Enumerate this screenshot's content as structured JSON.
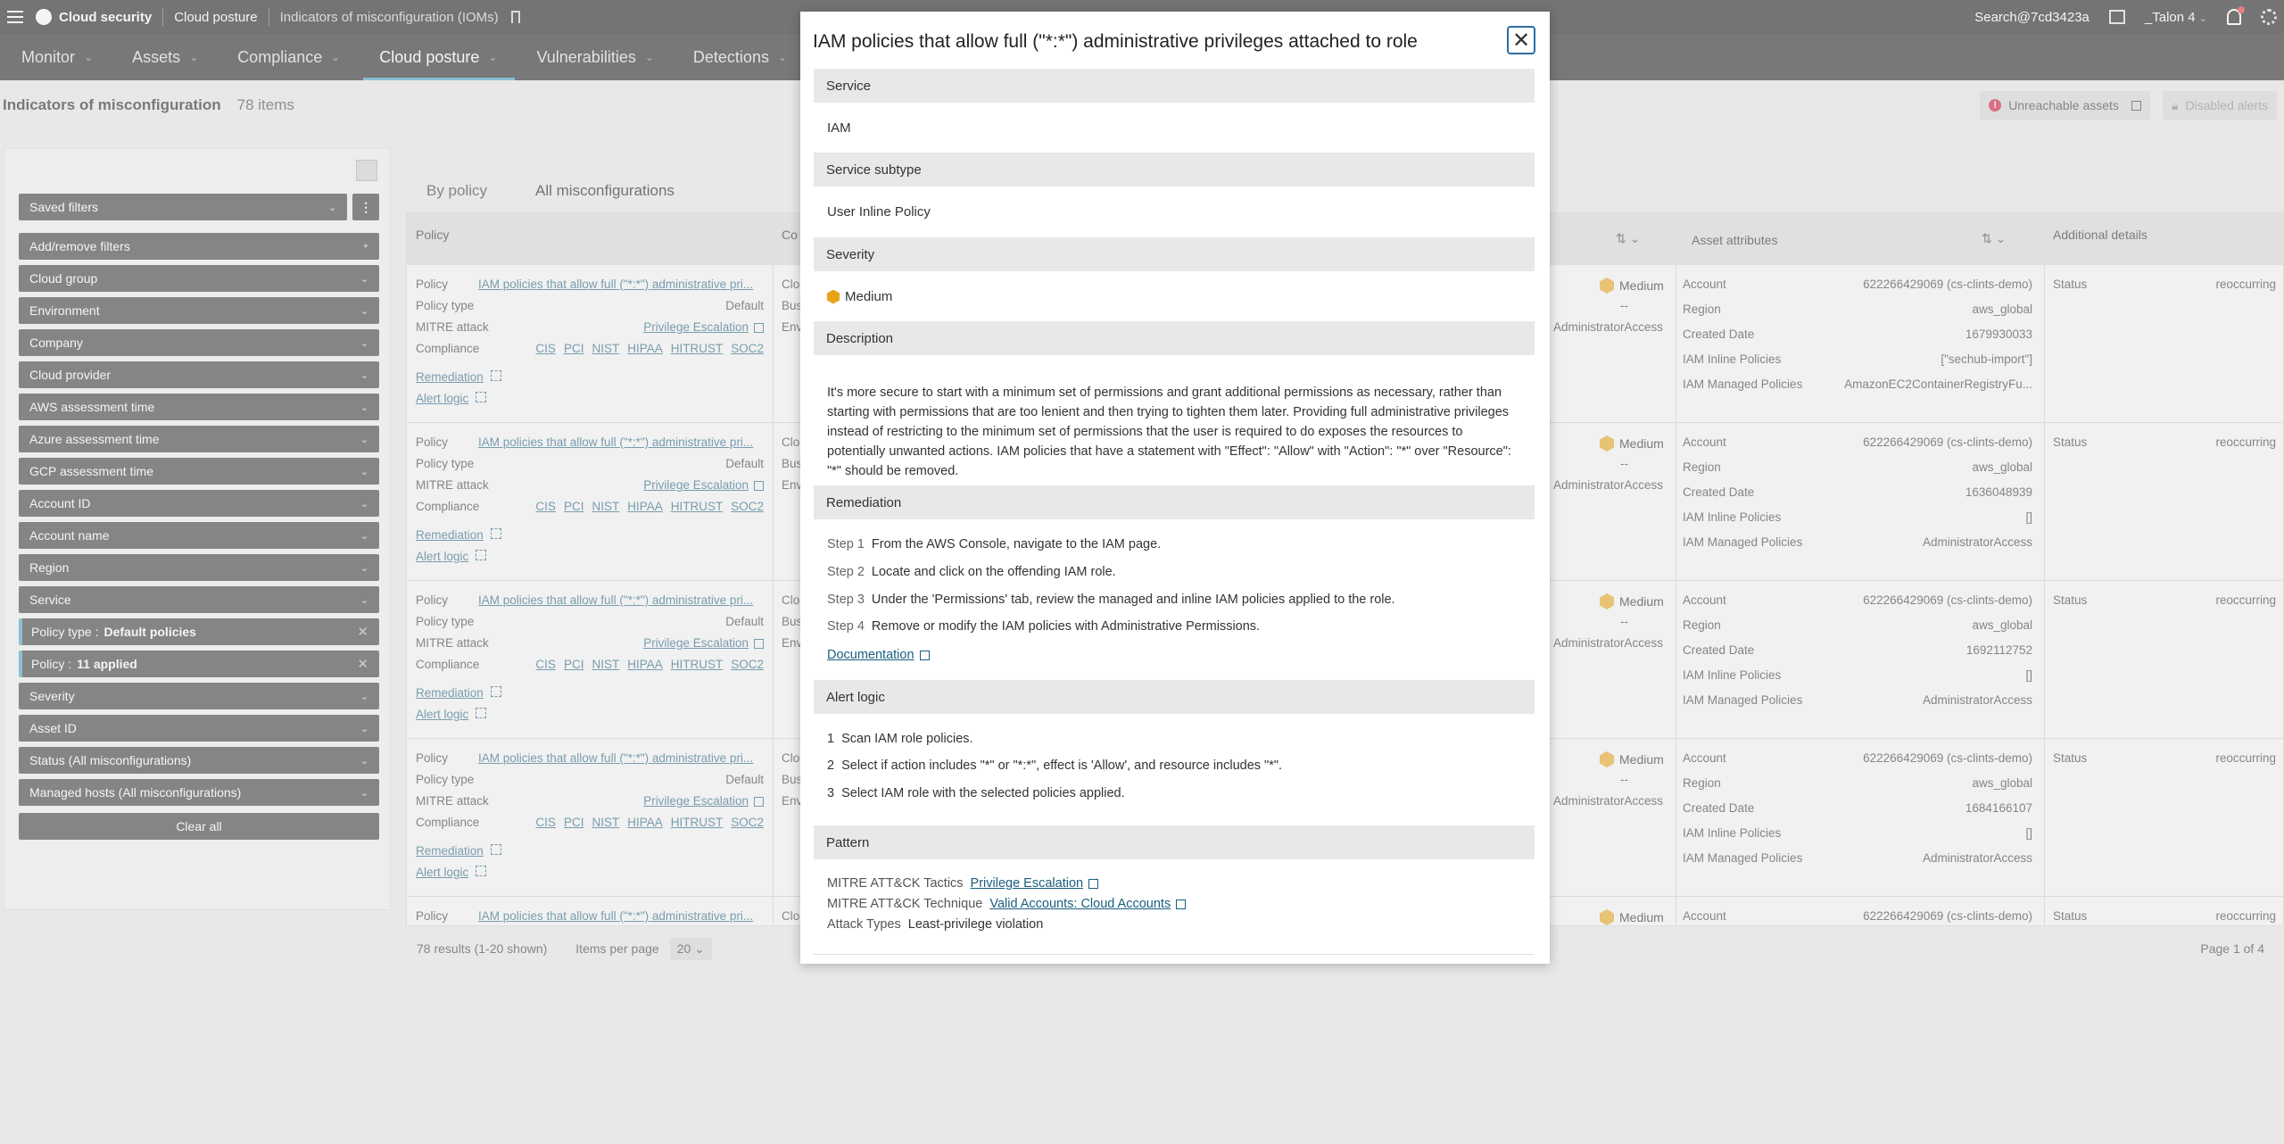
{
  "topbar": {
    "brand": "Cloud security",
    "crumb1": "Cloud posture",
    "crumb2": "Indicators of misconfiguration (IOMs)",
    "search": "Search@7cd3423a",
    "user": "_Talon 4"
  },
  "nav": [
    {
      "label": "Monitor"
    },
    {
      "label": "Assets"
    },
    {
      "label": "Compliance"
    },
    {
      "label": "Cloud posture"
    },
    {
      "label": "Vulnerabilities"
    },
    {
      "label": "Detections"
    }
  ],
  "page": {
    "title": "Indicators of misconfiguration",
    "count": "78 items",
    "unreachable": "Unreachable assets",
    "disabled": "Disabled alerts"
  },
  "filters": {
    "saved": "Saved filters",
    "items": [
      "Add/remove filters",
      "Cloud group",
      "Environment",
      "Company",
      "Cloud provider",
      "AWS assessment time",
      "Azure assessment time",
      "GCP assessment time",
      "Account ID",
      "Account name",
      "Region",
      "Service"
    ],
    "applied": [
      {
        "key": "Policy type :",
        "value": "Default policies"
      },
      {
        "key": "Policy :",
        "value": "11 applied"
      }
    ],
    "items2": [
      "Severity",
      "Asset ID",
      "Status (All misconfigurations)",
      "Managed hosts (All misconfigurations)"
    ],
    "clear": "Clear all"
  },
  "tabs": [
    "By policy",
    "All misconfigurations"
  ],
  "table": {
    "headers": {
      "policy": "Policy",
      "co": "Co",
      "asset_attributes": "Asset attributes",
      "additional": "Additional details"
    },
    "labels": {
      "policy": "Policy",
      "policy_type": "Policy type",
      "mitre": "MITRE attack",
      "compliance": "Compliance",
      "remediation": "Remediation",
      "alert_logic": "Alert logic",
      "account": "Account",
      "region": "Region",
      "created": "Created Date",
      "inline": "IAM Inline Policies",
      "managed": "IAM Managed Policies",
      "status": "Status",
      "stub1": "Clo",
      "stub2": "Bus",
      "stub3": "Env",
      "dash": "--"
    },
    "rows": [
      {
        "policy": "IAM policies that allow full (\"*:*\") administrative pri...",
        "policy_type": "Default",
        "mitre": "Privilege Escalation",
        "compliance": [
          "CIS",
          "PCI",
          "NIST",
          "HIPAA",
          "HITRUST",
          "SOC2"
        ],
        "severity": "Medium",
        "mid": "AdministratorAccess",
        "account": "622266429069 (cs-clints-demo)",
        "region": "aws_global",
        "created": "1679930033",
        "inline": "[\"sechub-import\"]",
        "managed": "AmazonEC2ContainerRegistryFu...",
        "status": "reoccurring"
      },
      {
        "policy": "IAM policies that allow full (\"*:*\") administrative pri...",
        "policy_type": "Default",
        "mitre": "Privilege Escalation",
        "compliance": [
          "CIS",
          "PCI",
          "NIST",
          "HIPAA",
          "HITRUST",
          "SOC2"
        ],
        "severity": "Medium",
        "mid": "AdministratorAccess",
        "account": "622266429069 (cs-clints-demo)",
        "region": "aws_global",
        "created": "1636048939",
        "inline": "[]",
        "managed": "AdministratorAccess",
        "status": "reoccurring"
      },
      {
        "policy": "IAM policies that allow full (\"*:*\") administrative pri...",
        "policy_type": "Default",
        "mitre": "Privilege Escalation",
        "compliance": [
          "CIS",
          "PCI",
          "NIST",
          "HIPAA",
          "HITRUST",
          "SOC2"
        ],
        "severity": "Medium",
        "mid": "AdministratorAccess",
        "account": "622266429069 (cs-clints-demo)",
        "region": "aws_global",
        "created": "1692112752",
        "inline": "[]",
        "managed": "AdministratorAccess",
        "status": "reoccurring"
      },
      {
        "policy": "IAM policies that allow full (\"*:*\") administrative pri...",
        "policy_type": "Default",
        "mitre": "Privilege Escalation",
        "compliance": [
          "CIS",
          "PCI",
          "NIST",
          "HIPAA",
          "HITRUST",
          "SOC2"
        ],
        "severity": "Medium",
        "mid": "AdministratorAccess",
        "account": "622266429069 (cs-clints-demo)",
        "region": "aws_global",
        "created": "1684166107",
        "inline": "[]",
        "managed": "AdministratorAccess",
        "status": "reoccurring"
      },
      {
        "policy": "IAM policies that allow full (\"*:*\") administrative pri...",
        "severity": "Medium",
        "account": "622266429069 (cs-clints-demo)",
        "status": "reoccurring"
      }
    ],
    "footer": {
      "results": "78 results (1-20 shown)",
      "ipp_label": "Items per page",
      "ipp": "20",
      "page": "Page 1 of 4"
    }
  },
  "modal": {
    "title": "IAM policies that allow full (\"*:*\") administrative privileges attached to role",
    "service_h": "Service",
    "service": "IAM",
    "subtype_h": "Service subtype",
    "subtype": "User Inline Policy",
    "severity_h": "Severity",
    "severity": "Medium",
    "description_h": "Description",
    "description": "It's more secure to start with a minimum set of permissions and grant additional permissions as necessary, rather than starting with permissions that are too lenient and then trying to tighten them later. Providing full administrative privileges instead of restricting to the minimum set of permissions that the user is required to do exposes the resources to potentially unwanted actions. IAM policies that have a statement with \"Effect\": \"Allow\" with \"Action\": \"*\" over \"Resource\": \"*\" should be removed.",
    "remediation_h": "Remediation",
    "steps": [
      {
        "n": "Step 1",
        "t": "From the AWS Console, navigate to the IAM page."
      },
      {
        "n": "Step 2",
        "t": "Locate and click on the offending IAM role."
      },
      {
        "n": "Step 3",
        "t": "Under the 'Permissions' tab, review the managed and inline IAM policies applied to the role."
      },
      {
        "n": "Step 4",
        "t": "Remove or modify the IAM policies with Administrative Permissions."
      }
    ],
    "documentation": "Documentation",
    "alert_h": "Alert logic",
    "alert": [
      {
        "n": "1",
        "t": "Scan IAM role policies."
      },
      {
        "n": "2",
        "t": "Select if action includes \"*\" or \"*:*\", effect is 'Allow', and resource includes \"*\"."
      },
      {
        "n": "3",
        "t": "Select IAM role with the selected policies applied."
      }
    ],
    "pattern_h": "Pattern",
    "pattern": {
      "tactics_k": "MITRE ATT&CK Tactics",
      "tactics_v": "Privilege Escalation",
      "technique_k": "MITRE ATT&CK Technique",
      "technique_v": "Valid Accounts: Cloud Accounts",
      "types_k": "Attack Types",
      "types_v": "Least-privilege violation"
    }
  }
}
